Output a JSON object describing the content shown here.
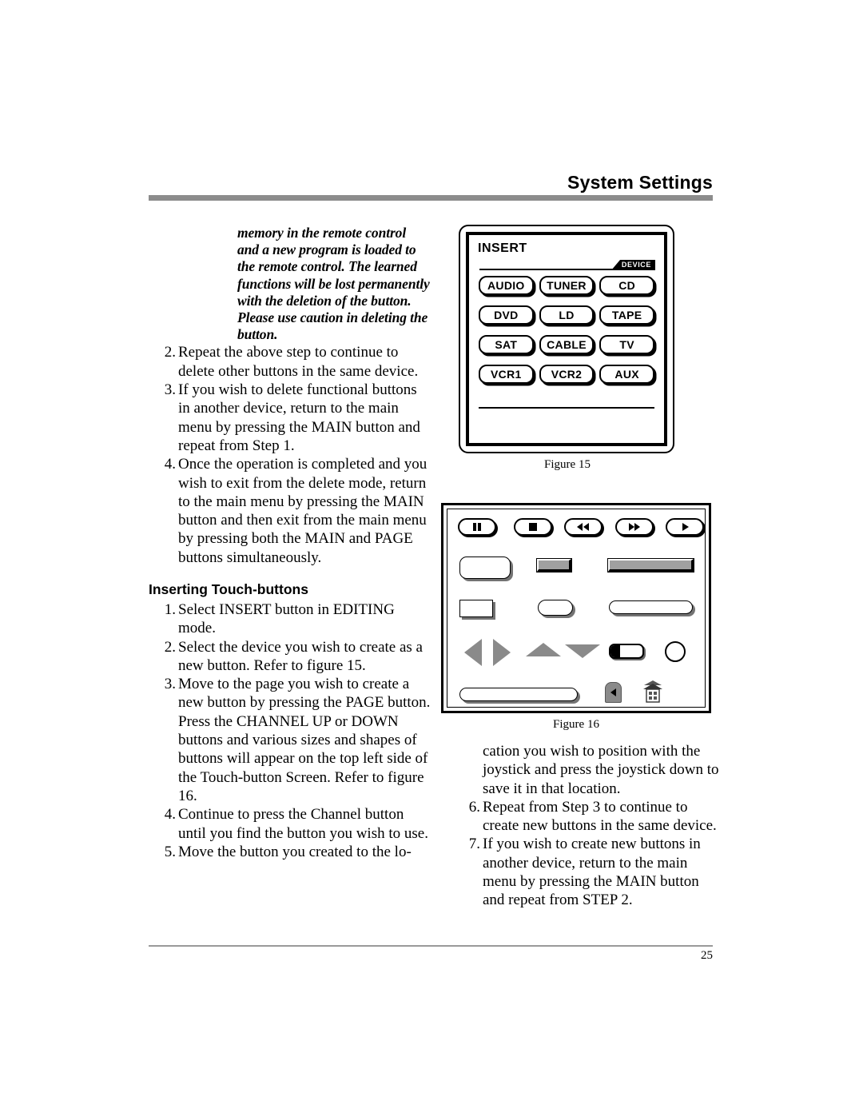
{
  "header": {
    "title": "System Settings"
  },
  "left_column": {
    "intro_note": "memory in the remote control and a new program is loaded to the remote control. The learned functions will be lost permanently with the deletion of the button. Please use caution in deleting the button.",
    "steps_deleting": [
      {
        "num": "2.",
        "text": "Repeat the above step to continue to delete other buttons in the same device."
      },
      {
        "num": "3.",
        "text": "If you wish to delete functional buttons in another device, return to the main menu by pressing the MAIN button and repeat from Step 1."
      },
      {
        "num": "4.",
        "text": "Once the operation is completed and you wish to exit from the delete mode, return to the main menu by pressing the MAIN button and then exit from the main menu by pressing both the MAIN and PAGE buttons simultaneously."
      }
    ],
    "section_heading": "Inserting Touch-buttons",
    "steps_inserting": [
      {
        "num": "1.",
        "text": "Select INSERT button in EDITING mode."
      },
      {
        "num": "2.",
        "text": "Select the device you wish to create as a new button. Refer to figure 15."
      },
      {
        "num": "3.",
        "text": "Move to the page you wish to create a new button by pressing the PAGE button. Press the CHANNEL UP or DOWN buttons and various sizes and shapes of buttons will appear on the top left side of the Touch-button Screen. Refer to figure 16."
      },
      {
        "num": "4.",
        "text": "Continue to press the Channel button until you find the button you wish to use."
      },
      {
        "num": "5.",
        "text": "Move the button you created to the lo-"
      }
    ]
  },
  "right_column": {
    "continuation": "cation you wish to position with the joystick and press the joystick down to save it in that location.",
    "steps_inserting_cont": [
      {
        "num": "6.",
        "text": "Repeat from Step 3 to continue to create new buttons in the same device."
      },
      {
        "num": "7.",
        "text": "If you wish to create new buttons in another device, return to the main menu by pressing the MAIN button and repeat from STEP 2."
      }
    ]
  },
  "figure15": {
    "caption": "Figure 15",
    "screen_title": "INSERT",
    "tab_label": "DEVICE",
    "device_buttons": [
      "AUDIO",
      "TUNER",
      "CD",
      "DVD",
      "LD",
      "TAPE",
      "SAT",
      "CABLE",
      "TV",
      "VCR1",
      "VCR2",
      "AUX"
    ]
  },
  "figure16": {
    "caption": "Figure 16",
    "media_buttons": [
      "pause",
      "stop",
      "rewind",
      "fast-forward",
      "play"
    ],
    "shape_rows": [
      [
        "large-rounded-rect",
        "short-gray-bevel-bar",
        "long-gray-bevel-bar"
      ],
      [
        "small-rect",
        "small-pill",
        "long-pill"
      ],
      [
        "left-triangle",
        "right-triangle",
        "up-triangle",
        "down-triangle",
        "half-filled-pill",
        "circle"
      ],
      [
        "wide-pill",
        "back-button",
        "home-house"
      ]
    ]
  },
  "footer": {
    "page_number": "25"
  },
  "colors": {
    "header_bar": "#8c8c8c",
    "shape_gray": "#8a8a8a",
    "bevel_gray": "#a0a0a0",
    "ink": "#000000",
    "paper": "#ffffff"
  }
}
